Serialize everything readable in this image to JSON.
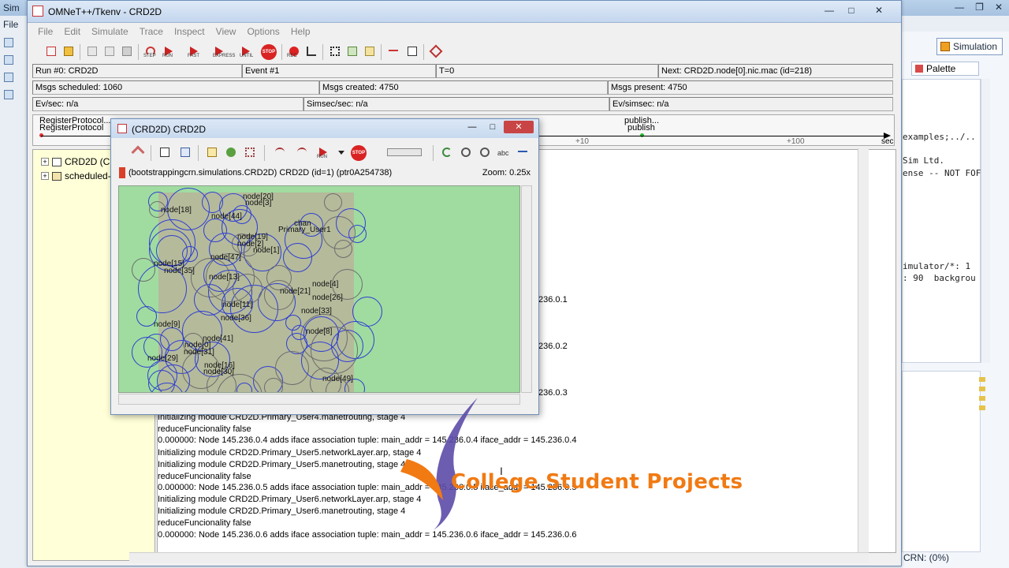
{
  "ide": {
    "window_title": "Sim",
    "menu_file": "File",
    "simulation_label": "Simulation",
    "palette_label": "Palette",
    "code_lines": [
      "examples;../..",
      "Sim Ltd.",
      "ense -- NOT FOF",
      "imulator/*: 1",
      ": 90  backgrou"
    ],
    "status": "CRN: (0%)"
  },
  "tkenv": {
    "title": "OMNeT++/Tkenv - CRD2D",
    "menus": [
      "File",
      "Edit",
      "Simulate",
      "Trace",
      "Inspect",
      "View",
      "Options",
      "Help"
    ],
    "toolbar_small_labels": [
      "STEP",
      "RUN",
      "FAST",
      "EXPRESS",
      "UNTIL",
      "STOP",
      "REC"
    ],
    "run": "Run #0: CRD2D",
    "event": "Event #1",
    "time": "T=0",
    "next": "Next: CRD2D.node[0].nic.mac (id=218)",
    "msgs_scheduled": "Msgs scheduled: 1060",
    "msgs_created": "Msgs created: 4750",
    "msgs_present": "Msgs present: 4750",
    "ev_sec": "Ev/sec: n/a",
    "simsec_sec": "Simsec/sec: n/a",
    "ev_simsec": "Ev/simsec: n/a",
    "timeline": {
      "label_a1": "RegisterProtocol...",
      "label_a2": "RegisterProtocol",
      "label_b1": "publish...",
      "label_b2": "publish",
      "tick_10": "+10",
      "tick_100": "+100",
      "unit": "sec"
    },
    "tree": [
      {
        "label": "CRD2D (CR"
      },
      {
        "label": "scheduled-"
      }
    ],
    "log_lines_top": [
      {
        "text": "236.0.1"
      },
      {
        "text": "236.0.2"
      },
      {
        "text": "236.0.3"
      }
    ],
    "log_lines": [
      "Initializing module CRD2D.Primary_User4.manetrouting, stage 4",
      "reduceFuncionality false",
      "0.000000: Node 145.236.0.4 adds iface association tuple: main_addr = 145.236.0.4 iface_addr = 145.236.0.4",
      "Initializing module CRD2D.Primary_User5.networkLayer.arp, stage 4",
      "Initializing module CRD2D.Primary_User5.manetrouting, stage 4",
      "reduceFuncionality false",
      "0.000000: Node 145.236.0.5 adds iface association tuple: main_addr = 145.236.0.5 iface_addr = 145.236.0.5",
      "Initializing module CRD2D.Primary_User6.networkLayer.arp, stage 4",
      "Initializing module CRD2D.Primary_User6.manetrouting, stage 4",
      "reduceFuncionality false",
      "0.000000: Node 145.236.0.6 adds iface association tuple: main_addr = 145.236.0.6 iface_addr = 145.236.0.6"
    ]
  },
  "inspector": {
    "title": "(CRD2D) CRD2D",
    "path": "(bootstrappingcrn.simulations.CRD2D) CRD2D  (id=1)  (ptr0A254738)",
    "zoom": "Zoom: 0.25x",
    "run_small": "RUN",
    "stop_small": "STOP",
    "abc": "abc",
    "node_labels": [
      "node[20]",
      "node[3]",
      "node[18]",
      "node[44]",
      "chan",
      "Primary_User1",
      "node[19]",
      "node[2]",
      "node[1]",
      "node[47]",
      "node[15]",
      "node[35]",
      "node[13]",
      "node[4]",
      "node[21]",
      "node[26]",
      "node[11]",
      "node[33]",
      "node[36]",
      "node[9]",
      "node[8]",
      "node[41]",
      "node[0]",
      "node[31]",
      "node[29]",
      "node[16]",
      "node[30]",
      "node[49]"
    ]
  },
  "watermark": {
    "brand": "College Student Projects"
  }
}
